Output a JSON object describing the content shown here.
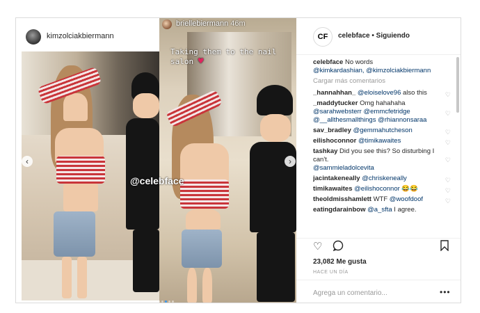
{
  "post_left": {
    "username": "kimzolciakbiermann"
  },
  "post_right": {
    "username": "briellebiermann",
    "time": "46m",
    "caption": "Taking them to the nail salon"
  },
  "watermark": "@celebface",
  "sidebar": {
    "account": "celebface",
    "avatar_text": "CF",
    "follow_status": "• Siguiendo",
    "caption_user": "celebface",
    "caption_text": "No words",
    "caption_mentions": "@kimkardashian, @kimzolciakbiermann",
    "load_more": "Cargar más comentarios",
    "comments": [
      {
        "user": "_hannahhan_",
        "mention": "@eloiselove96",
        "text": " also this"
      },
      {
        "user": "_maddytucker",
        "mention": "",
        "text": "Omg hahahaha"
      },
      {
        "user": "",
        "mention": "@sarahwebsterr @emmcfetridge @__allthesmallthings @rhiannonsaraa",
        "text": ""
      },
      {
        "user": "sav_bradley",
        "mention": "@gemmahutcheson",
        "text": ""
      },
      {
        "user": "eilishoconnor",
        "mention": "@timikawaites",
        "text": ""
      },
      {
        "user": "tashkay",
        "mention": "",
        "text": "Did you see this? So disturbing I can't."
      },
      {
        "user": "",
        "mention": "@sammieladolcevita",
        "text": ""
      },
      {
        "user": "jacintakeneally",
        "mention": "@chriskeneally",
        "text": ""
      },
      {
        "user": "timikawaites",
        "mention": "@eilishoconnor",
        "text": " 😂😂"
      },
      {
        "user": "theoldmisshamlett",
        "mention": "",
        "text": "WTF "
      },
      {
        "user": "eatingdarainbow",
        "mention": "@a_sfta",
        "text": " I agree."
      }
    ],
    "woofdoof": "@woofdoof",
    "likes": "23,082 Me gusta",
    "when": "HACE UN DÍA",
    "add_comment_placeholder": "Agrega un comentario...",
    "more_icon": "•••"
  },
  "icons": [
    "heart-icon",
    "comment-icon",
    "bookmark-icon",
    "chevron-left-icon",
    "chevron-right-icon"
  ]
}
